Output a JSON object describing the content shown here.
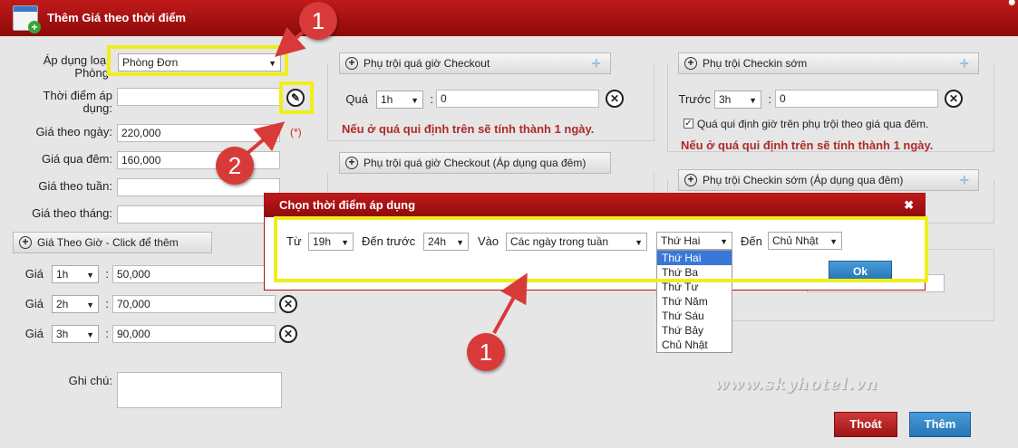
{
  "title": "Thêm Giá theo thời điểm",
  "form": {
    "room_type_label": "Áp dụng loại Phòng",
    "room_type_value": "Phòng Đơn",
    "time_label": "Thời điểm áp dụng:",
    "time_value": "",
    "price_day_label": "Giá theo ngày:",
    "price_day_value": "220,000",
    "price_night_label": "Giá qua đêm:",
    "price_night_value": "160,000",
    "price_week_label": "Giá theo tuần:",
    "price_week_value": "",
    "price_month_label": "Giá theo tháng:",
    "price_month_value": "",
    "required_mark": "(*)",
    "hourly_header": "Giá Theo Giờ - Click để thêm",
    "hourly_rows": [
      {
        "label": "Giá",
        "hour": "1h",
        "sep": ":",
        "value": "50,000"
      },
      {
        "label": "Giá",
        "hour": "2h",
        "sep": ":",
        "value": "70,000"
      },
      {
        "label": "Giá",
        "hour": "3h",
        "sep": ":",
        "value": "90,000"
      }
    ],
    "note_label": "Ghi chú:",
    "note_value": ""
  },
  "checkout": {
    "header": "Phụ trội quá giờ Checkout",
    "label": "Quá",
    "hour": "1h",
    "sep": ":",
    "value": "0",
    "warning": "Nếu ở quá qui định trên sẽ tính thành 1 ngày."
  },
  "checkout_night": {
    "header": "Phụ trội quá giờ Checkout (Áp dụng qua đêm)"
  },
  "checkin": {
    "header": "Phụ trội Checkin sớm",
    "label": "Trước",
    "hour": "3h",
    "sep": ":",
    "value": "0",
    "checkbox_label": "Quá qui định giờ trên phụ trội theo giá qua đêm.",
    "warning": "Nếu ở quá qui định trên sẽ tính thành 1 ngày."
  },
  "checkin_night": {
    "header": "Phụ trội Checkin sớm (Áp dụng qua đêm)"
  },
  "dialog": {
    "title": "Chọn thời điểm áp dụng",
    "close": "✖",
    "from_label": "Từ",
    "from_value": "19h",
    "to_label": "Đến trước",
    "to_value": "24h",
    "into_label": "Vào",
    "into_value": "Các ngày trong tuần",
    "day_from": "Thứ Hai",
    "day_to_label": "Đến",
    "day_to_value": "Chủ Nhật",
    "ok": "Ok",
    "day_options": [
      "Thứ Hai",
      "Thứ Ba",
      "Thứ Tư",
      "Thứ Năm",
      "Thứ Sáu",
      "Thứ Bảy",
      "Chủ Nhật"
    ]
  },
  "annotations": {
    "badge1": "1",
    "badge2": "2",
    "badge3": "1"
  },
  "buttons": {
    "exit": "Thoát",
    "add": "Thêm"
  },
  "watermark": "www.skyhotel.vn",
  "colors": {
    "header_red": "#a81212",
    "highlight": "#f0ee1a",
    "accent_blue": "#2676b8"
  }
}
